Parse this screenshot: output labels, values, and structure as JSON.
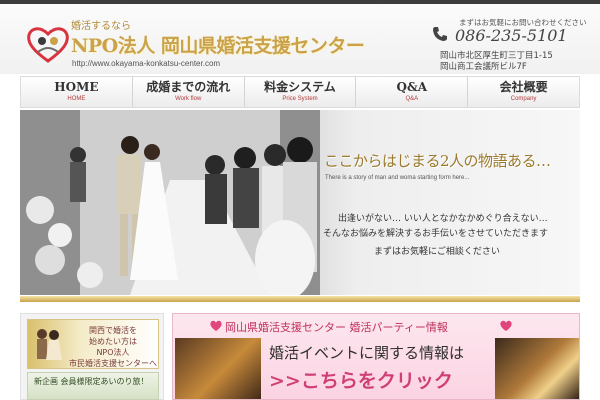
{
  "header": {
    "logo_tagline": "婚活するなら",
    "logo_name": "NPO法人 岡山県婚活支援センター",
    "site_url": "http://www.okayama-konkatsu-center.com",
    "phone_note": "まずはお気軽にお問い合わせください",
    "phone_number": "086-235-5101",
    "address_line1": "岡山市北区厚生町三丁目1-15",
    "address_line2": "岡山商工会議所ビル7F"
  },
  "nav": {
    "items": [
      {
        "label": "HOME",
        "sub": "HOME"
      },
      {
        "label": "成婚までの流れ",
        "sub": "Work flow"
      },
      {
        "label": "料金システム",
        "sub": "Price System"
      },
      {
        "label": "Q&A",
        "sub": "Q&A"
      },
      {
        "label": "会社概要",
        "sub": "Company"
      }
    ]
  },
  "hero": {
    "tagline": "ここからはじまる2人の物語ある…",
    "tagline_en": "There is a story of man and woma  starting form here...",
    "line1": "出逢いがない…  いい人となかなかめぐり合えない…",
    "line2": "そんなお悩みを解決するお手伝いをさせていただきます",
    "line3": "まずはお気軽にご相談ください"
  },
  "side": {
    "banner1_line1": "関西で婚活を",
    "banner1_line2": "始めたい方は",
    "banner1_line3": "NPO法人",
    "banner1_line4": "市民婚活支援センターへ",
    "banner2_text": "新企画 会員様限定あいのり旅！"
  },
  "event": {
    "title": "岡山県婚活支援センター 婚活パーティー情報",
    "line1": "婚活イベントに関する情報は",
    "line2": ">>こちらをクリック"
  },
  "colors": {
    "gold": "#c9a24a",
    "pink": "#d03e76",
    "nav_sub": "#b33a3a"
  }
}
